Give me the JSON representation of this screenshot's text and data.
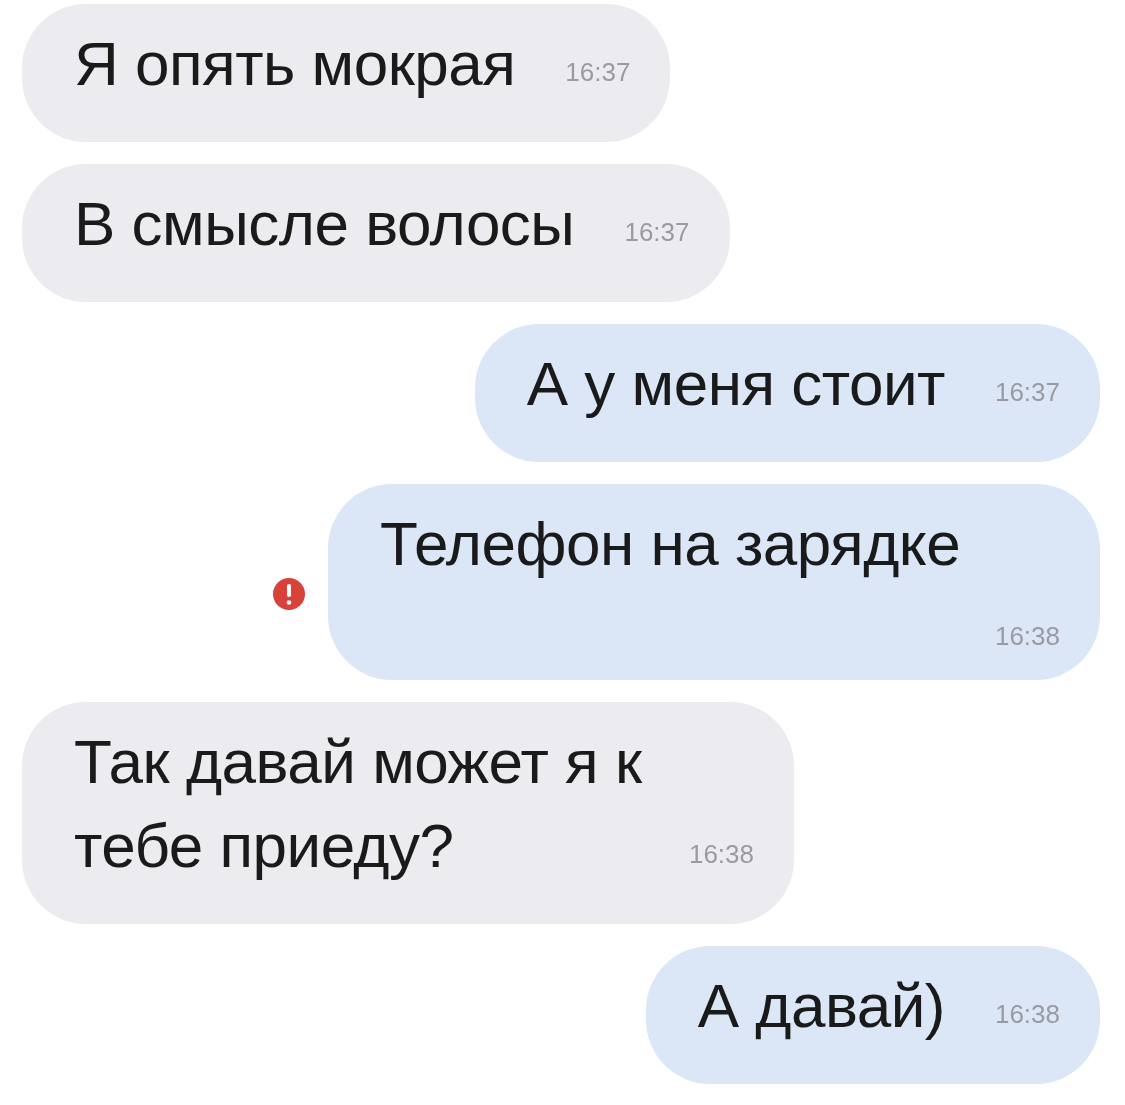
{
  "messages": [
    {
      "kind": "incoming",
      "text": "Я опять мокрая",
      "time": "16:37",
      "failed": false
    },
    {
      "kind": "incoming",
      "text": "В смысле волосы",
      "time": "16:37",
      "failed": false
    },
    {
      "kind": "outgoing",
      "text": "А у меня стоит",
      "time": "16:37",
      "failed": false
    },
    {
      "kind": "outgoing",
      "text": "Телефон на зарядке",
      "time": "16:38",
      "failed": true
    },
    {
      "kind": "incoming",
      "text": "Так давай может я к тебе приеду?",
      "time": "16:38",
      "failed": false
    },
    {
      "kind": "outgoing",
      "text": "А давай)",
      "time": "16:38",
      "failed": false
    }
  ]
}
